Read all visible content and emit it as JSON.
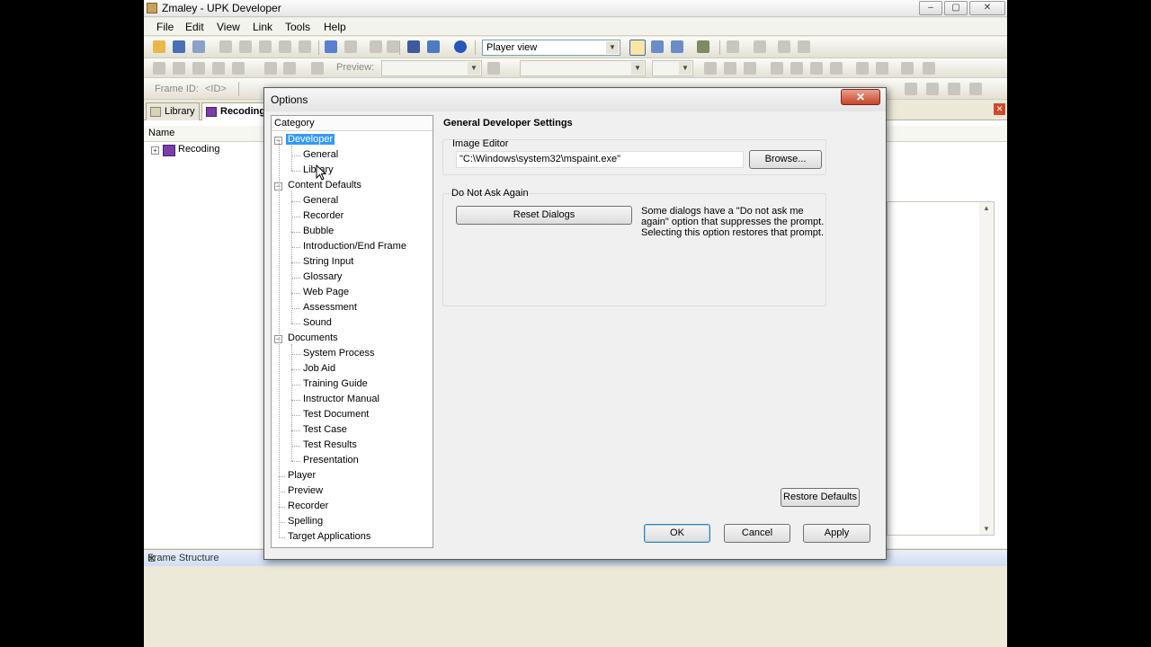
{
  "window": {
    "title": "Zmaley - UPK Developer",
    "buttons": [
      "–",
      "▢",
      "✕"
    ]
  },
  "menubar": [
    "File",
    "Edit",
    "View",
    "Link",
    "Tools",
    "Help"
  ],
  "toolbar1": {
    "view_mode": "Player view"
  },
  "toolbar2": {
    "preview_label": "Preview:"
  },
  "toolbar3": {
    "frame_id_label": "Frame ID:",
    "frame_id_value": "<ID>"
  },
  "tabs": [
    {
      "label": "Library"
    },
    {
      "label": "Recoding"
    }
  ],
  "library": {
    "column_name": "Name",
    "items": [
      {
        "label": "Recoding"
      }
    ]
  },
  "frame_structure": {
    "title": "Frame Structure"
  },
  "dialog": {
    "title": "Options",
    "close": "✕",
    "category_header": "Category",
    "tree": [
      {
        "label": "Developer",
        "level": 0,
        "expanded": true,
        "selected": true
      },
      {
        "label": "General",
        "level": 1
      },
      {
        "label": "Library",
        "level": 1
      },
      {
        "label": "Content Defaults",
        "level": 0,
        "expanded": true
      },
      {
        "label": "General",
        "level": 1
      },
      {
        "label": "Recorder",
        "level": 1
      },
      {
        "label": "Bubble",
        "level": 1
      },
      {
        "label": "Introduction/End Frame",
        "level": 1
      },
      {
        "label": "String Input",
        "level": 1
      },
      {
        "label": "Glossary",
        "level": 1
      },
      {
        "label": "Web Page",
        "level": 1
      },
      {
        "label": "Assessment",
        "level": 1
      },
      {
        "label": "Sound",
        "level": 1
      },
      {
        "label": "Documents",
        "level": 0,
        "expanded": true
      },
      {
        "label": "System Process",
        "level": 1
      },
      {
        "label": "Job Aid",
        "level": 1
      },
      {
        "label": "Training Guide",
        "level": 1
      },
      {
        "label": "Instructor Manual",
        "level": 1
      },
      {
        "label": "Test Document",
        "level": 1
      },
      {
        "label": "Test Case",
        "level": 1
      },
      {
        "label": "Test Results",
        "level": 1
      },
      {
        "label": "Presentation",
        "level": 1
      },
      {
        "label": "Player",
        "level": 0
      },
      {
        "label": "Preview",
        "level": 0
      },
      {
        "label": "Recorder",
        "level": 0
      },
      {
        "label": "Spelling",
        "level": 0
      },
      {
        "label": "Target Applications",
        "level": 0
      }
    ],
    "settings": {
      "title": "General Developer Settings",
      "image_editor_label": "Image Editor",
      "image_editor_path": "\"C:\\Windows\\system32\\mspaint.exe\"",
      "browse_label": "Browse...",
      "do_not_ask_label": "Do Not Ask Again",
      "reset_label": "Reset Dialogs",
      "reset_help": "Some dialogs have a \"Do not ask me again\" option that suppresses the prompt. Selecting this option restores that prompt.",
      "restore_defaults_label": "Restore Defaults"
    },
    "buttons": {
      "ok": "OK",
      "cancel": "Cancel",
      "apply": "Apply"
    }
  }
}
